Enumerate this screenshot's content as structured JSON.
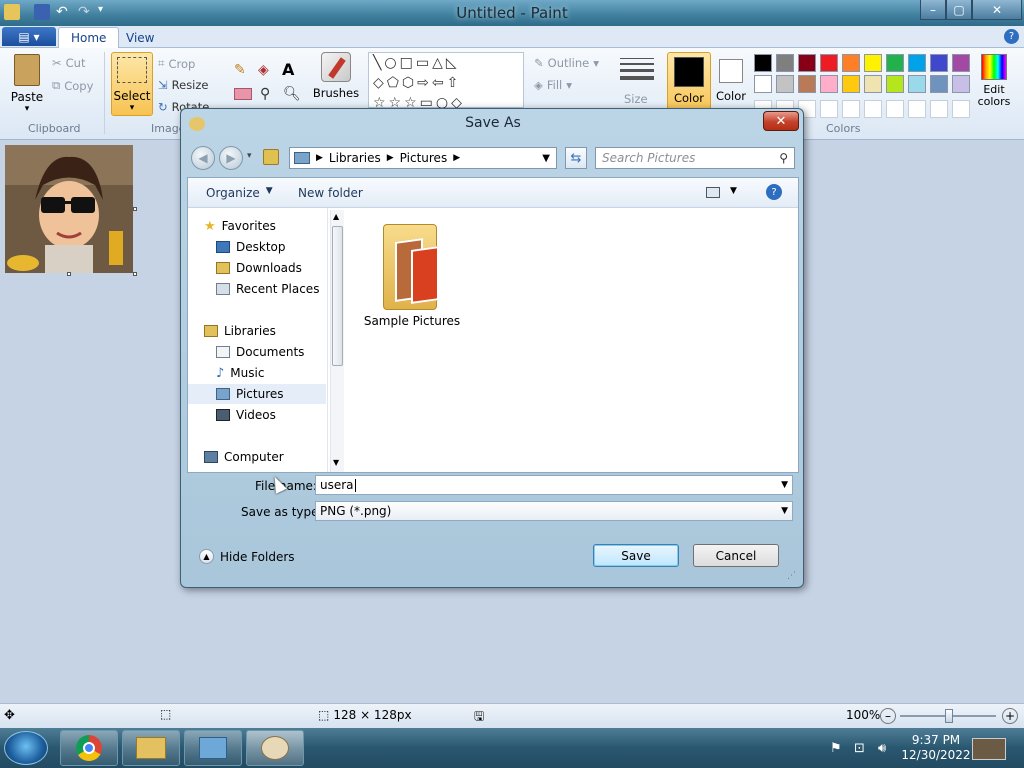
{
  "window": {
    "title": "Untitled - Paint"
  },
  "ribbon": {
    "tabs": [
      "Home",
      "View"
    ],
    "clipboard": {
      "paste": "Paste",
      "cut": "Cut",
      "copy": "Copy",
      "group": "Clipboard"
    },
    "image": {
      "select": "Select",
      "crop": "Crop",
      "resize": "Resize",
      "rotate": "Rotate",
      "group": "Image"
    },
    "tools": {
      "brushes": "Brushes"
    },
    "shapes": {
      "outline": "Outline",
      "fill": "Fill"
    },
    "size": "Size",
    "color1": "Color 1",
    "color2": "Color 2",
    "edit_colors": "Edit colors",
    "colors_group": "Colors",
    "palette": [
      "#000000",
      "#7f7f7f",
      "#880015",
      "#ed1c24",
      "#ff7f27",
      "#fff200",
      "#22b14c",
      "#00a2e8",
      "#3f48cc",
      "#a349a4",
      "#ffffff",
      "#c3c3c3",
      "#b97a57",
      "#ffaec9",
      "#ffc90e",
      "#efe4b0",
      "#b5e61d",
      "#99d9ea",
      "#7092be",
      "#c8bfe7"
    ]
  },
  "status": {
    "dimensions": "128 × 128px",
    "zoom": "100%"
  },
  "dialog": {
    "title": "Save As",
    "address": [
      "Libraries",
      "Pictures"
    ],
    "search_placeholder": "Search Pictures",
    "organize": "Organize",
    "new_folder": "New folder",
    "nav": {
      "favorites": "Favorites",
      "desktop": "Desktop",
      "downloads": "Downloads",
      "recent": "Recent Places",
      "libraries": "Libraries",
      "documents": "Documents",
      "music": "Music",
      "pictures": "Pictures",
      "videos": "Videos",
      "computer": "Computer"
    },
    "folder": "Sample Pictures",
    "file_name_label": "File name:",
    "file_name_value": "usera",
    "save_type_label": "Save as type:",
    "save_type_value": "PNG (*.png)",
    "hide_folders": "Hide Folders",
    "save": "Save",
    "cancel": "Cancel"
  },
  "taskbar": {
    "time": "9:37 PM",
    "date": "12/30/2022"
  }
}
